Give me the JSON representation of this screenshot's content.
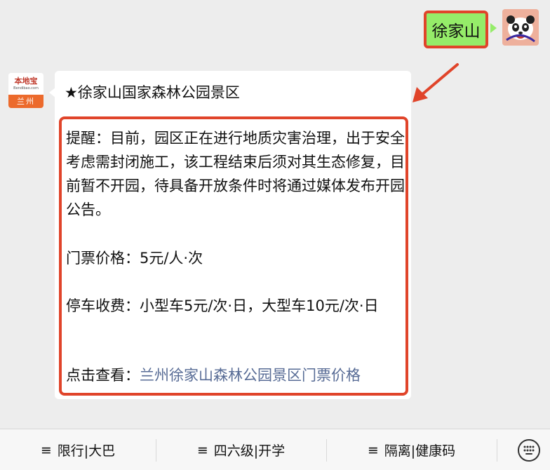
{
  "user_message": {
    "text": "徐家山"
  },
  "bot_avatar": {
    "logo_text": "本地宝",
    "logo_sub": "Bendibao.com",
    "city": "兰州"
  },
  "bot_message": {
    "title": "★徐家山国家森林公园景区",
    "notice": "提醒：目前，园区正在进行地质灾害治理，出于安全考虑需封闭施工，该工程结束后须对其生态修复，目前暂不开园，待具备开放条件时将通过媒体发布开园公告。",
    "ticket_price": "门票价格：5元/人·次",
    "parking_fee": "停车收费：小型车5元/次·日，大型车10元/次·日",
    "link_prefix": "点击查看：",
    "link_text": "兰州徐家山森林公园景区门票价格"
  },
  "bottom_menu": {
    "items": [
      {
        "icon": "≡",
        "label": "限行|大巴"
      },
      {
        "icon": "≡",
        "label": "四六级|开学"
      },
      {
        "icon": "≡",
        "label": "隔离|健康码"
      }
    ],
    "keyboard_icon": "keyboard-icon"
  },
  "colors": {
    "user_bubble": "#95ec69",
    "highlight": "#e0442a",
    "link": "#576b95",
    "background": "#ededed"
  }
}
